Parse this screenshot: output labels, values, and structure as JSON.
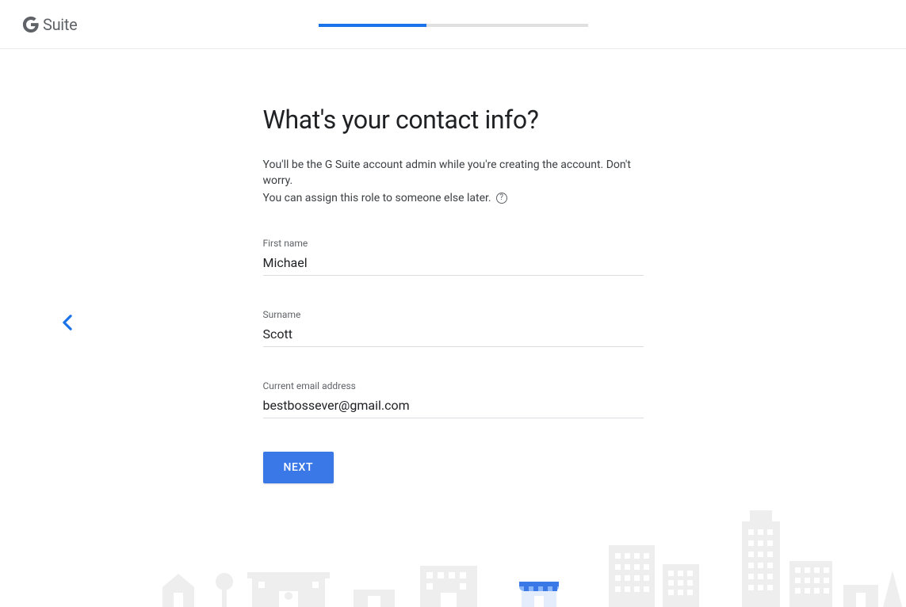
{
  "logo": {
    "suite": "Suite"
  },
  "progress": {
    "percent": 40
  },
  "heading": "What's your contact info?",
  "subtitle_line1": "You'll be the G Suite account admin while you're creating the account. Don't worry.",
  "subtitle_line2": "You can assign this role to someone else later.",
  "fields": {
    "first_name": {
      "label": "First name",
      "value": "Michael"
    },
    "surname": {
      "label": "Surname",
      "value": "Scott"
    },
    "email": {
      "label": "Current email address",
      "value": "bestbossever@gmail.com"
    }
  },
  "buttons": {
    "next": "Next"
  }
}
